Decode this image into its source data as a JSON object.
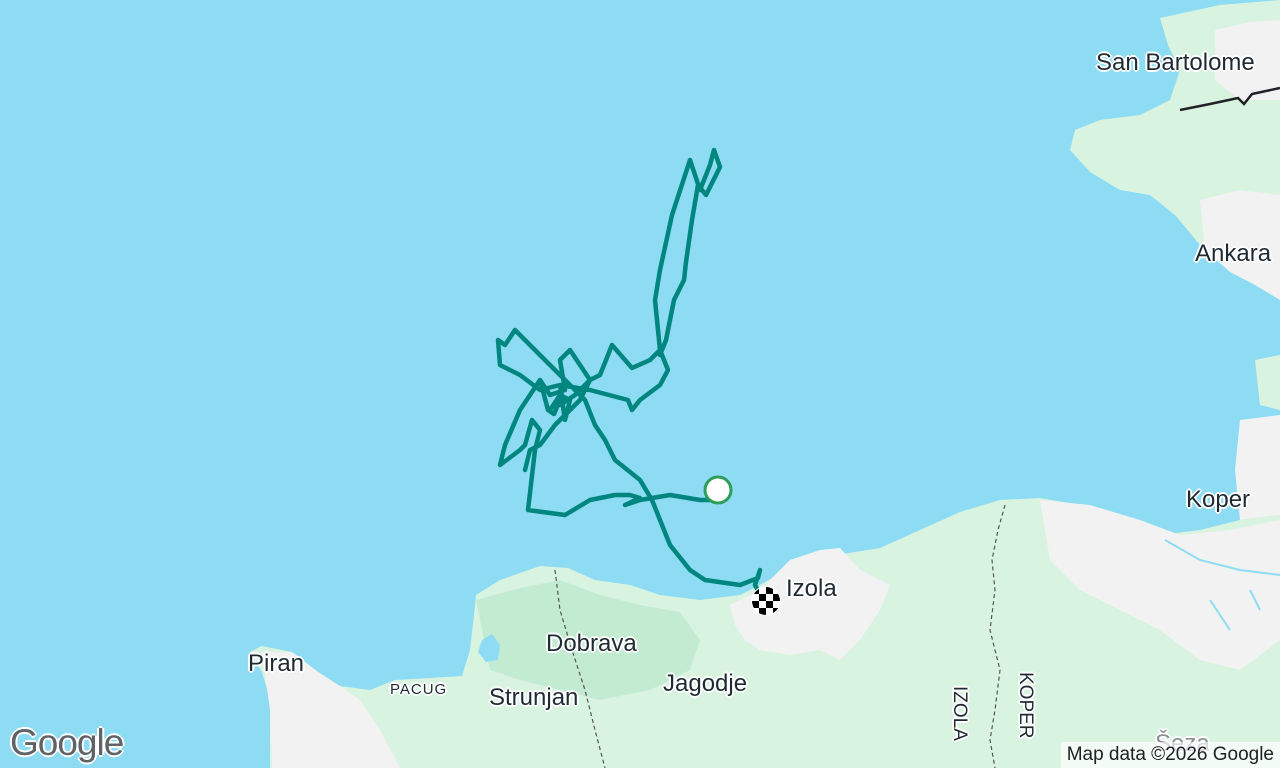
{
  "map": {
    "type": "route-map",
    "labels": {
      "san_bartolomeo": "San Bartolome",
      "ankaran": "Ankara",
      "koper": "Koper",
      "izola": "Izola",
      "dobrava": "Dobrava",
      "piran": "Piran",
      "pacug": "PACUG",
      "strunjan": "Strunjan",
      "jagodje": "Jagodje",
      "izola_road": "IZOLA",
      "koper_road": "KOPER",
      "sezara": "Šeza"
    },
    "logo": "Google",
    "attribution": "Map data ©2026 Google"
  },
  "colors": {
    "water": "#8ddcf4",
    "land": "#d9f3e1",
    "urban": "#f2f2f2",
    "route": "#00857f",
    "start_marker": "#ffffff",
    "start_marker_ring": "#2e9e5b",
    "border": "#202124"
  },
  "markers": {
    "start": "start-circle",
    "finish": "checkered-flag"
  }
}
